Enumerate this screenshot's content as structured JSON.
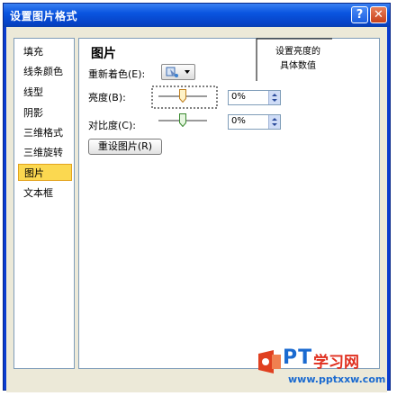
{
  "window": {
    "title": "设置图片格式",
    "help_button": "?",
    "close_button": "✕"
  },
  "nav": {
    "items": [
      {
        "label": "填充"
      },
      {
        "label": "线条颜色"
      },
      {
        "label": "线型"
      },
      {
        "label": "阴影"
      },
      {
        "label": "三维格式"
      },
      {
        "label": "三维旋转"
      },
      {
        "label": "图片",
        "selected": true
      },
      {
        "label": "文本框"
      }
    ]
  },
  "picture": {
    "section_title": "图片",
    "recolor_label": "重新着色(E):",
    "brightness_label": "亮度(B):",
    "brightness_value": "0%",
    "brightness_level": 0,
    "contrast_label": "对比度(C):",
    "contrast_value": "0%",
    "contrast_level": 0,
    "reset_button": "重设图片(R)"
  },
  "callout": {
    "line1": "设置亮度的",
    "line2": "具体数值"
  },
  "footer": {
    "ok_button": "",
    "close_button": ""
  },
  "watermark": {
    "brand": "PT",
    "brand2": "学习网",
    "url": "www.pptxxw.com"
  },
  "colors": {
    "titlebar": "#0a55e0",
    "selected_nav": "#fbd850",
    "dialog_bg": "#ece9d8",
    "callout_border": "#000000"
  }
}
